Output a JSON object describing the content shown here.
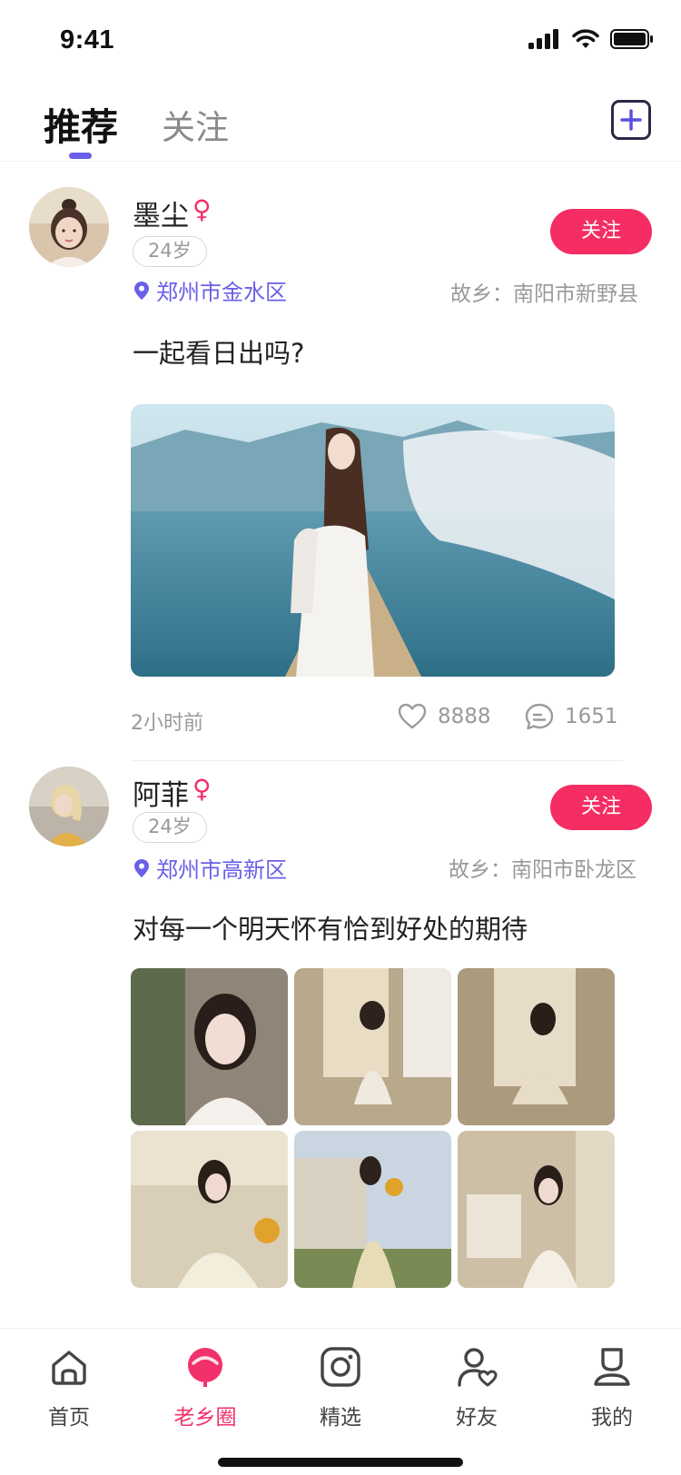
{
  "status_bar": {
    "time": "9:41"
  },
  "top_nav": {
    "tabs": [
      {
        "label": "推荐",
        "active": true
      },
      {
        "label": "关注",
        "active": false
      }
    ]
  },
  "posts": [
    {
      "username": "墨尘",
      "gender": "♀",
      "age": "24岁",
      "follow_label": "关注",
      "location": "郑州市金水区",
      "hometown": "故乡：南阳市新野县",
      "text": "一起看日出吗?",
      "time": "2小时前",
      "likes": "8888",
      "comments": "1651"
    },
    {
      "username": "阿菲",
      "gender": "♀",
      "age": "24岁",
      "follow_label": "关注",
      "location": "郑州市高新区",
      "hometown": "故乡：南阳市卧龙区",
      "text": "对每一个明天怀有恰到好处的期待"
    }
  ],
  "tab_bar": {
    "items": [
      {
        "label": "首页",
        "icon": "home-icon"
      },
      {
        "label": "老乡圈",
        "icon": "lollipop-icon",
        "active": true
      },
      {
        "label": "精选",
        "icon": "camera-icon"
      },
      {
        "label": "好友",
        "icon": "friend-heart-icon"
      },
      {
        "label": "我的",
        "icon": "profile-icon"
      }
    ]
  },
  "colors": {
    "accent_purple": "#6a5fe8",
    "accent_pink": "#f52d63"
  }
}
